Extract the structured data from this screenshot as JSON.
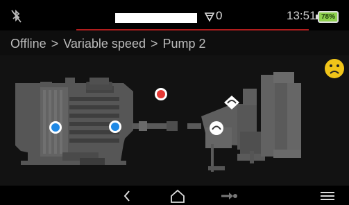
{
  "status_bar": {
    "bluetooth_icon": "bluetooth-off-icon",
    "field_value": "",
    "alarm_count": "0",
    "time": "13:51",
    "battery_percent": "78%",
    "battery_level": 0.78,
    "accent_color": "#b11d1d"
  },
  "breadcrumb": {
    "items": [
      "Offline",
      "Variable speed",
      "Pump 2"
    ],
    "separator": ">"
  },
  "status_face": {
    "icon": "sad-face-icon",
    "color": "#f0c419"
  },
  "diagram": {
    "motor_points": [
      {
        "color": "#1e88e5"
      },
      {
        "color": "#1e88e5"
      }
    ],
    "red_indicator": {
      "color": "#e53935"
    },
    "pump_points": [
      "pump-sensor-icon",
      "pump-sensor-icon"
    ]
  },
  "navbar": {
    "buttons": [
      "back-icon",
      "home-icon",
      "next-arrow-icon",
      "menu-icon"
    ]
  }
}
